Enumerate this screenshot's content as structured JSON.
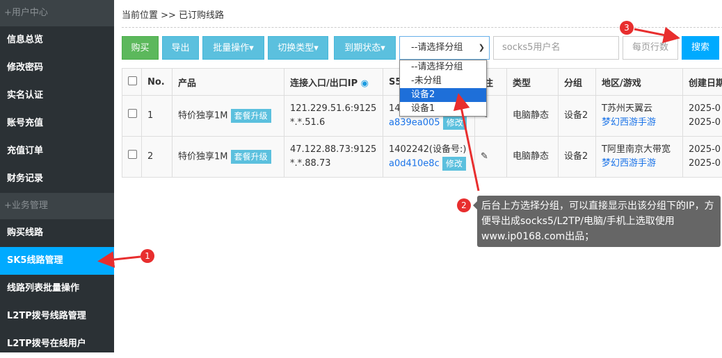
{
  "sidebar": {
    "sections": [
      {
        "title": "+用户中心",
        "items": [
          "信息总览",
          "修改密码",
          "实名认证",
          "账号充值",
          "充值订单",
          "财务记录"
        ]
      },
      {
        "title": "+业务管理",
        "items": [
          "购买线路",
          "SK5线路管理",
          "线路列表批量操作",
          "L2TP拨号线路管理",
          "L2TP拨号在线用户"
        ]
      }
    ],
    "active": "SK5线路管理"
  },
  "breadcrumb": "当前位置 >> 已订购线路",
  "toolbar": {
    "buy": "购买",
    "export": "导出",
    "batch": "批量操作▾",
    "switch_type": "切换类型▾",
    "expiry": "到期状态▾",
    "group_select": "--请选择分组",
    "user_placeholder": "socks5用户名",
    "per_page_placeholder": "每页行数",
    "search": "搜索"
  },
  "dropdown": {
    "options": [
      "--请选择分组",
      "-未分组",
      "设备2",
      "设备1"
    ],
    "highlighted": "设备2"
  },
  "table": {
    "headers": [
      "No.",
      "产品",
      "连接入口/出口IP",
      "S5",
      "备注",
      "类型",
      "分组",
      "地区/游戏",
      "创建日期"
    ],
    "rows": [
      {
        "no": "1",
        "product": "特价独享1M",
        "upgrade": "套餐升级",
        "ip1": "121.229.51.6:9125",
        "ip2": "*.*.51.6",
        "s5a": "14",
        "s5b": "a839ea005",
        "edit": "修改",
        "type": "电脑静态",
        "group": "设备2",
        "region": "T苏州天翼云",
        "game": "梦幻西游手游",
        "date1": "2025-0",
        "date2": "2025-0"
      },
      {
        "no": "2",
        "product": "特价独享1M",
        "upgrade": "套餐升级",
        "ip1": "47.122.88.73:9125",
        "ip2": "*.*.88.73",
        "s5a": "1402242(设备号:)",
        "s5b": "a0d410e8c",
        "edit": "修改",
        "type": "电脑静态",
        "group": "设备2",
        "region": "T阿里南京大带宽",
        "game": "梦幻西游手游",
        "date1": "2025-0",
        "date2": "2025-0"
      }
    ]
  },
  "annotations": {
    "n1": "1",
    "n2": "2",
    "n3": "3",
    "note": "后台上方选择分组，可以直接显示出该分组下的IP，方便导出成socks5/L2TP/电脑/手机上选取使用",
    "credit": "www.ip0168.com出品；"
  },
  "colors": {
    "accent": "#00aaff",
    "green": "#5cb85c",
    "info": "#5bc0de",
    "sidebar": "#2b3135",
    "annotation": "#e82e2e"
  }
}
